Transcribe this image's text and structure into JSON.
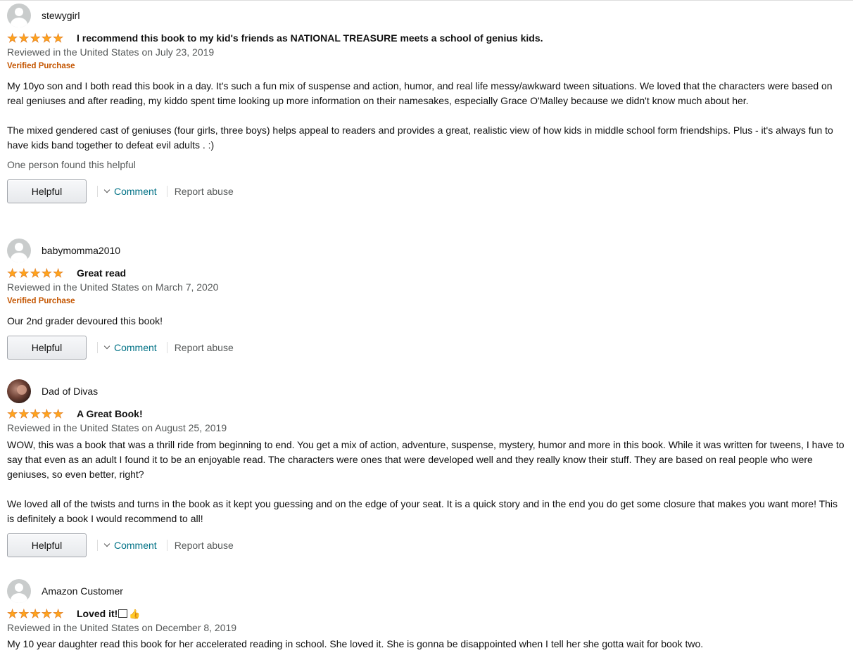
{
  "reviews": [
    {
      "name": "stewygirl",
      "avatar_icon": "default-user-avatar-icon",
      "rating": 5,
      "title": "I recommend this book to my kid's friends as NATIONAL TREASURE meets a school of genius kids.",
      "meta": "Reviewed in the United States on July 23, 2019",
      "verified": "Verified Purchase",
      "paragraphs": [
        "My 10yo son and I both read this book in a day. It's such a fun mix of suspense and action, humor, and real life messy/awkward tween situations. We loved that the characters were based on real geniuses and after reading, my kiddo spent time looking up more information on their namesakes, especially Grace O'Malley because we didn't know much about her.",
        "The mixed gendered cast of geniuses (four girls, three boys) helps appeal to readers and provides a great, realistic view of how kids in middle school form friendships. Plus - it's always fun to have kids band together to defeat evil adults . :)"
      ],
      "helpful_count": "One person found this helpful",
      "helpful_label": "Helpful",
      "comment_label": "Comment",
      "report_label": "Report abuse"
    },
    {
      "name": "babymomma2010",
      "avatar_icon": "default-user-avatar-icon",
      "rating": 5,
      "title": "Great read",
      "meta": "Reviewed in the United States on March 7, 2020",
      "verified": "Verified Purchase",
      "paragraphs": [
        "Our 2nd grader devoured this book!"
      ],
      "helpful_label": "Helpful",
      "comment_label": "Comment",
      "report_label": "Report abuse"
    },
    {
      "name": "Dad of Divas",
      "avatar_icon": "user-photo-avatar",
      "rating": 5,
      "title": "A Great Book!",
      "meta": "Reviewed in the United States on August 25, 2019",
      "paragraphs": [
        "WOW, this was a book that was a thrill ride from beginning to end. You get a mix of action, adventure, suspense, mystery, humor and more in this book. While it was written for tweens, I have to say that even as an adult I found it to be an enjoyable read. The characters were ones that were developed well and they really know their stuff. They are based on real people who were geniuses, so even better, right?",
        "We loved all of the twists and turns in the book as it kept you guessing and on the edge of your seat. It is a quick story and in the end you do get some closure that makes you want more! This is definitely a book I would recommend to all!"
      ],
      "helpful_label": "Helpful",
      "comment_label": "Comment",
      "report_label": "Report abuse"
    },
    {
      "name": "Amazon Customer",
      "avatar_icon": "default-user-avatar-icon",
      "rating": 5,
      "title": "Loved it!",
      "title_icons": [
        "book-emoji-icon",
        "thumbs-up-icon"
      ],
      "meta": "Reviewed in the United States on December 8, 2019",
      "paragraphs": [
        "My 10 year daughter read this book for her accelerated reading in school. She loved it. She is gonna be disappointed when I tell her she gotta wait for book two."
      ]
    }
  ],
  "colors": {
    "star": "#ffa41c",
    "verified": "#c45500",
    "link": "#007185",
    "meta": "#565959"
  }
}
